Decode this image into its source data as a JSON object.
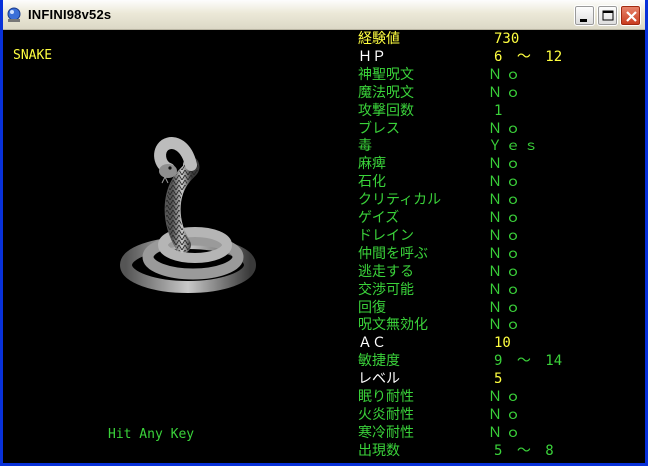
{
  "window": {
    "title": "INFINI98v52s"
  },
  "monster": {
    "name": "SNAKE",
    "image_icon": "snake-icon"
  },
  "prompt": "Hit Any Key",
  "stats": [
    {
      "label": "経験値",
      "value": "730",
      "label_color": "yellow",
      "value_color": "yellow"
    },
    {
      "label": "ＨＰ",
      "value": "6 ～ 12",
      "label_color": "white",
      "value_color": "yellow"
    },
    {
      "label": "神聖呪文",
      "value": "Ｎｏ",
      "label_color": "green",
      "value_color": "green"
    },
    {
      "label": "魔法呪文",
      "value": "Ｎｏ",
      "label_color": "green",
      "value_color": "green"
    },
    {
      "label": "攻撃回数",
      "value": "1",
      "label_color": "green",
      "value_color": "green"
    },
    {
      "label": "ブレス",
      "value": "Ｎｏ",
      "label_color": "green",
      "value_color": "green"
    },
    {
      "label": "毒",
      "value": "Ｙｅｓ",
      "label_color": "green",
      "value_color": "green"
    },
    {
      "label": "麻痺",
      "value": "Ｎｏ",
      "label_color": "green",
      "value_color": "green"
    },
    {
      "label": "石化",
      "value": "Ｎｏ",
      "label_color": "green",
      "value_color": "green"
    },
    {
      "label": "クリティカル",
      "value": "Ｎｏ",
      "label_color": "green",
      "value_color": "green"
    },
    {
      "label": "ゲイズ",
      "value": "Ｎｏ",
      "label_color": "green",
      "value_color": "green"
    },
    {
      "label": "ドレイン",
      "value": "Ｎｏ",
      "label_color": "green",
      "value_color": "green"
    },
    {
      "label": "仲間を呼ぶ",
      "value": "Ｎｏ",
      "label_color": "green",
      "value_color": "green"
    },
    {
      "label": "逃走する",
      "value": "Ｎｏ",
      "label_color": "green",
      "value_color": "green"
    },
    {
      "label": "交渉可能",
      "value": "Ｎｏ",
      "label_color": "green",
      "value_color": "green"
    },
    {
      "label": "回復",
      "value": "Ｎｏ",
      "label_color": "green",
      "value_color": "green"
    },
    {
      "label": "呪文無効化",
      "value": "Ｎｏ",
      "label_color": "green",
      "value_color": "green"
    },
    {
      "label": "ＡＣ",
      "value": "10",
      "label_color": "white",
      "value_color": "yellow"
    },
    {
      "label": "敏捷度",
      "value": "9 ～ 14",
      "label_color": "green",
      "value_color": "green"
    },
    {
      "label": "レベル",
      "value": "5",
      "label_color": "white",
      "value_color": "yellow"
    },
    {
      "label": "眠り耐性",
      "value": "Ｎｏ",
      "label_color": "green",
      "value_color": "green"
    },
    {
      "label": "火炎耐性",
      "value": "Ｎｏ",
      "label_color": "green",
      "value_color": "green"
    },
    {
      "label": "寒冷耐性",
      "value": "Ｎｏ",
      "label_color": "green",
      "value_color": "green"
    },
    {
      "label": "出現数",
      "value": "5 ～ 8",
      "label_color": "green",
      "value_color": "green"
    }
  ],
  "colors": {
    "yellow": "#ffff40",
    "green": "#3ad23a",
    "white": "#ffffff",
    "background": "#000000"
  },
  "titlebar_buttons": [
    "minimize-icon",
    "maximize-icon",
    "close-icon"
  ]
}
